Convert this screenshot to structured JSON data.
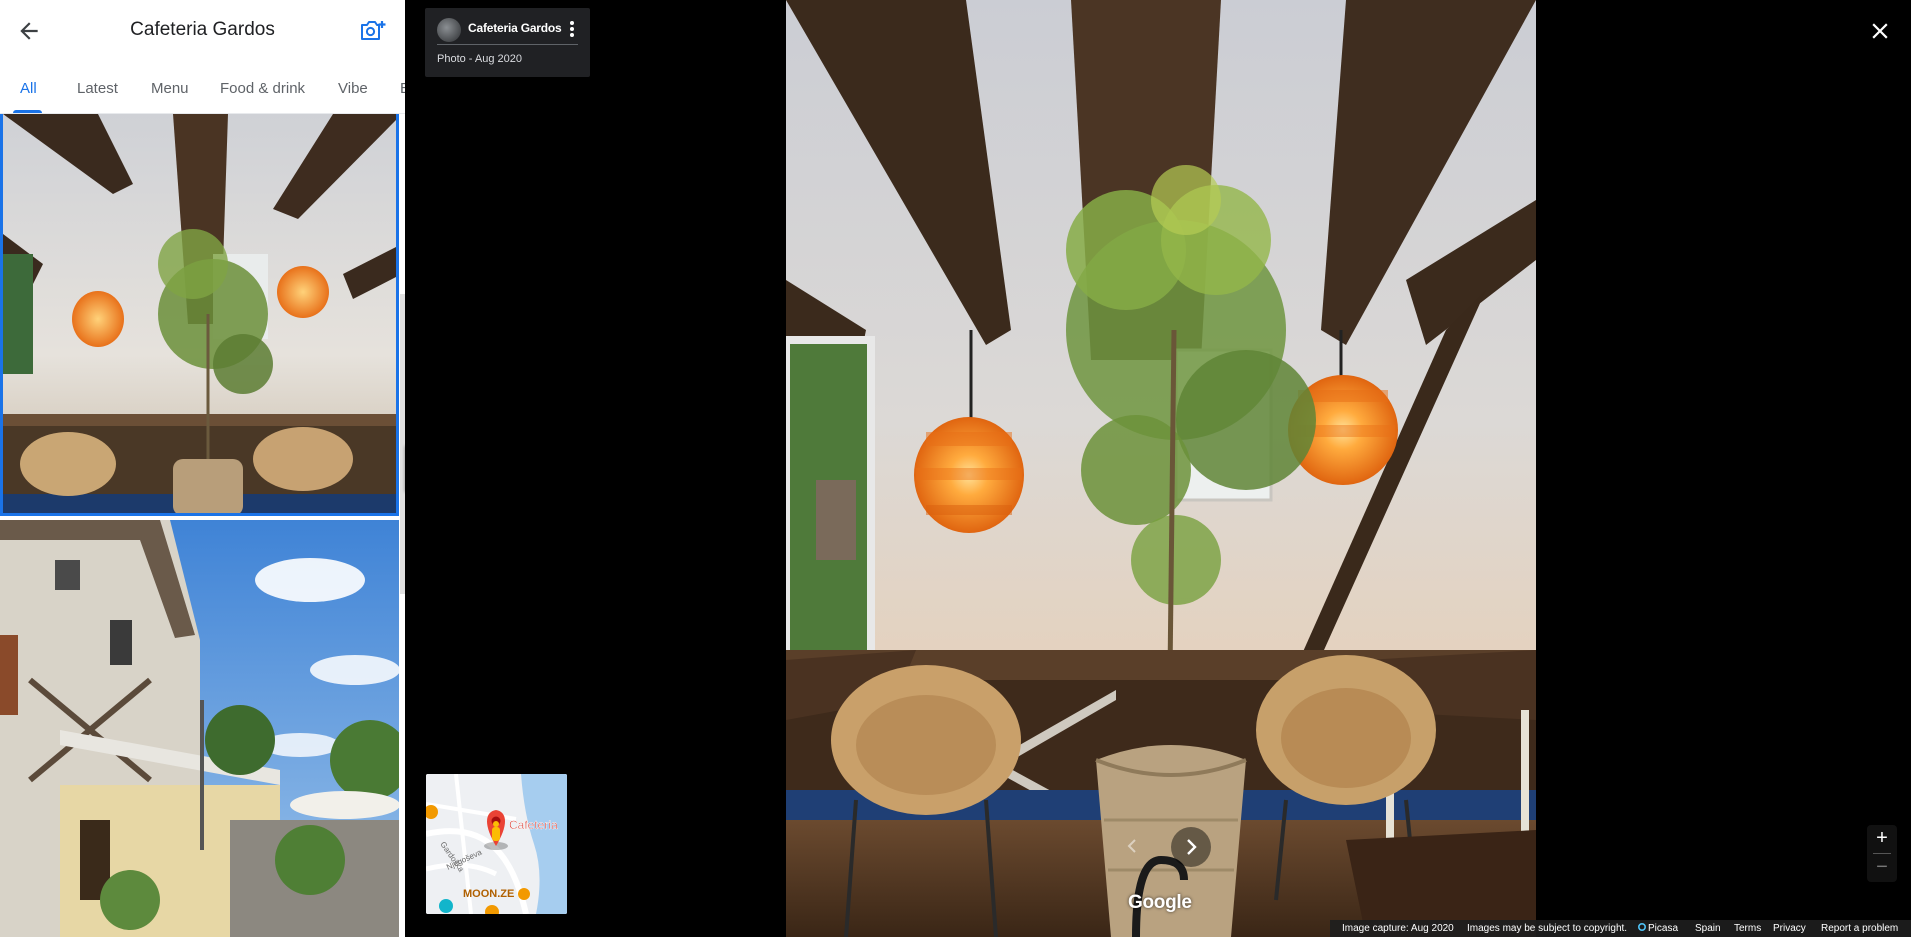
{
  "panel": {
    "title": "Cafeteria Gardos",
    "back_icon": "arrow-back-icon",
    "add_photo_icon": "add-photo-camera-icon",
    "tabs": [
      {
        "label": "All",
        "active": true
      },
      {
        "label": "Latest",
        "active": false
      },
      {
        "label": "Menu",
        "active": false
      },
      {
        "label": "Food & drink",
        "active": false
      },
      {
        "label": "Vibe",
        "active": false
      },
      {
        "label": "B",
        "active": false
      }
    ]
  },
  "viewer": {
    "author_name": "Cafeteria Gardos",
    "photo_meta": "Photo - Aug 2020",
    "close_icon": "close-icon",
    "logo": "Google",
    "zoom_in": "+",
    "zoom_out": "−",
    "minimap": {
      "place_label": "Cafeteria",
      "street_1": "Gardoška",
      "street_2": "Njegoševa",
      "poi_label": "MOON.ZE"
    }
  },
  "footer": {
    "capture": "Image capture: Aug 2020",
    "copyright": "Images may be subject to copyright.",
    "picasa": "Picasa",
    "country": "Spain",
    "terms": "Terms",
    "privacy": "Privacy",
    "report": "Report a problem"
  },
  "colors": {
    "accent": "#1a73e8",
    "pin": "#ea4335",
    "viewer_bg": "#000000",
    "card_bg": "#202124"
  }
}
